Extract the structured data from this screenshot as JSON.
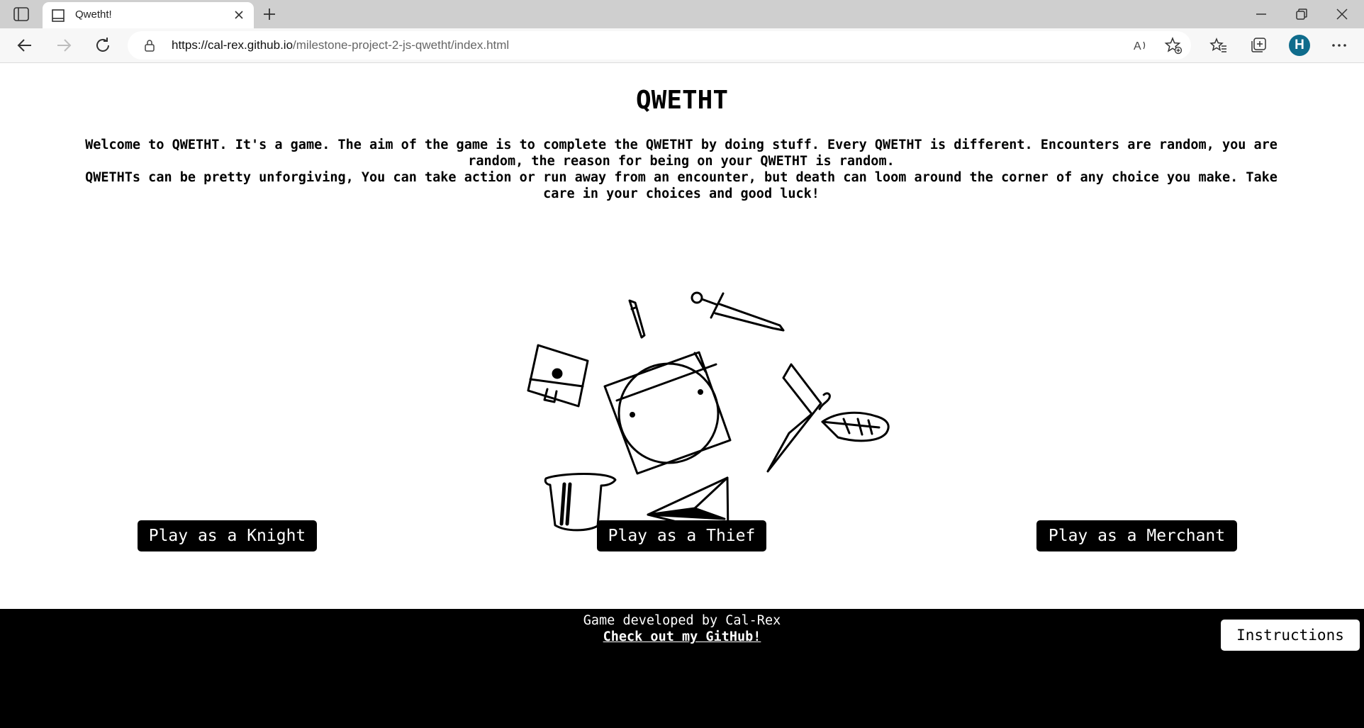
{
  "browser": {
    "tab_title": "Qwetht!",
    "url_host": "https://cal-rex.github.io",
    "url_path": "/milestone-project-2-js-qwetht/index.html",
    "profile_initial": "H",
    "icons": {
      "tab_actions": "tab-actions-icon",
      "favicon": "page-favicon-icon",
      "close_tab": "close-icon",
      "new_tab": "plus-icon",
      "back": "back-arrow-icon",
      "forward": "forward-arrow-icon",
      "refresh": "refresh-icon",
      "lock": "lock-icon",
      "read_aloud": "read-aloud-icon",
      "add_favorite": "add-favorite-icon",
      "favorites": "favorites-icon",
      "collections": "collections-icon",
      "more": "more-icon",
      "minimize": "minimize-icon",
      "restore": "restore-icon",
      "close_window": "close-window-icon"
    }
  },
  "main": {
    "title": "QWETHT",
    "intro_1": "Welcome to QWETHT. It's a game. The aim of the game is to complete the QWETHT by doing stuff. Every QWETHT is different. Encounters are random, you are random, the reason for being on your QWETHT is random.",
    "intro_2": "QWETHTs can be pretty unforgiving, You can take action or run away from an encounter, but death can loom around the corner of any choice you make. Take care in your choices and good luck!",
    "buttons": {
      "knight": "Play as a Knight",
      "thief": "Play as a Thief",
      "merchant": "Play as a Merchant"
    }
  },
  "footer": {
    "credit": "Game developed by Cal-Rex",
    "github_link": "Check out my GitHub!",
    "instructions": "Instructions"
  },
  "colors": {
    "footer_bg": "#000000",
    "button_bg": "#000000",
    "button_text": "#ffffff",
    "profile_bg": "#0f6c8c"
  }
}
